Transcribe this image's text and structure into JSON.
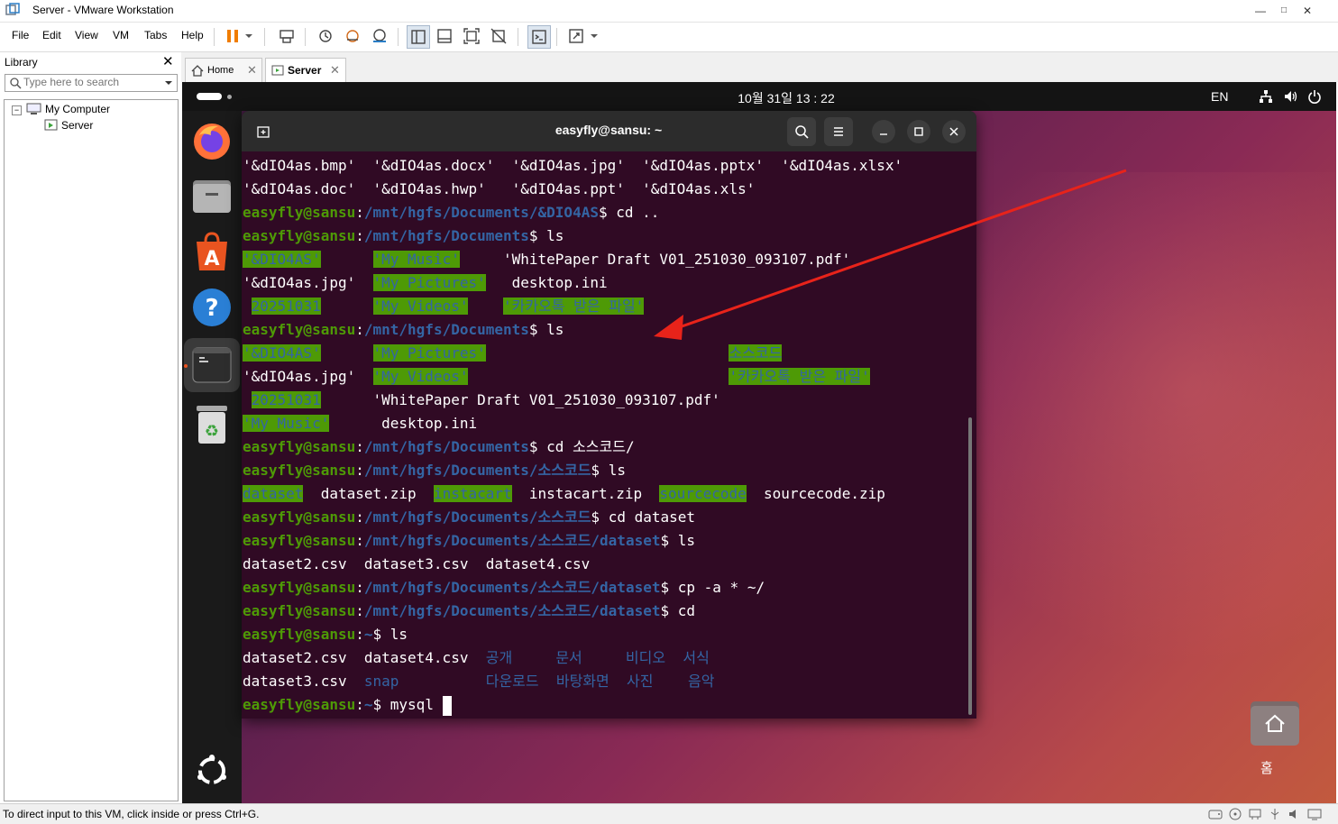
{
  "window": {
    "title": "Server - VMware Workstation",
    "minimize": "—",
    "maximize": "□",
    "close": "✕"
  },
  "menu": {
    "items": [
      "File",
      "Edit",
      "View",
      "VM",
      "Tabs",
      "Help"
    ]
  },
  "library": {
    "title": "Library",
    "close": "✕",
    "search_placeholder": "Type here to search",
    "tree": {
      "root": "My Computer",
      "child": "Server",
      "expander": "−"
    }
  },
  "tabs": [
    {
      "label": "Home",
      "active": false
    },
    {
      "label": "Server",
      "active": true
    }
  ],
  "vm": {
    "clock": "10월 31일  13 : 22",
    "lang": "EN",
    "terminal_title": "easyfly@sansu: ~",
    "home_folder_label": "홈"
  },
  "terminal": {
    "lines": [
      [
        {
          "t": "'&dIO4as.bmp'  '&dIO4as.docx'  '&dIO4as.jpg'  '&dIO4as.pptx'  '&dIO4as.xlsx'",
          "c": "w"
        }
      ],
      [
        {
          "t": "'&dIO4as.doc'  '&dIO4as.hwp'   '&dIO4as.ppt'  '&dIO4as.xls'",
          "c": "w"
        }
      ],
      [
        {
          "t": "easyfly@sansu",
          "c": "u"
        },
        {
          "t": ":",
          "c": "w"
        },
        {
          "t": "/mnt/hgfs/Documents/&DIO4AS",
          "c": "p"
        },
        {
          "t": "$ cd ..",
          "c": "w"
        }
      ],
      [
        {
          "t": "easyfly@sansu",
          "c": "u"
        },
        {
          "t": ":",
          "c": "w"
        },
        {
          "t": "/mnt/hgfs/Documents",
          "c": "p"
        },
        {
          "t": "$ ls",
          "c": "w"
        }
      ],
      [
        {
          "t": "'&DIO4AS'",
          "c": "h"
        },
        {
          "t": "      ",
          "c": "w"
        },
        {
          "t": "'My Music'",
          "c": "h"
        },
        {
          "t": "     'WhitePaper Draft V01_251030_093107.pdf'",
          "c": "w"
        }
      ],
      [
        {
          "t": "'&dIO4as.jpg'  ",
          "c": "w"
        },
        {
          "t": "'My Pictures'",
          "c": "h"
        },
        {
          "t": "   desktop.ini",
          "c": "w"
        }
      ],
      [
        {
          "t": " ",
          "c": "w"
        },
        {
          "t": "20251031",
          "c": "h"
        },
        {
          "t": "      ",
          "c": "w"
        },
        {
          "t": "'My Videos'",
          "c": "h"
        },
        {
          "t": "    ",
          "c": "w"
        },
        {
          "t": "'카카오톡 받은 파일'",
          "c": "h"
        }
      ],
      [
        {
          "t": "easyfly@sansu",
          "c": "u"
        },
        {
          "t": ":",
          "c": "w"
        },
        {
          "t": "/mnt/hgfs/Documents",
          "c": "p"
        },
        {
          "t": "$ ls",
          "c": "w"
        }
      ],
      [
        {
          "t": "'&DIO4AS'",
          "c": "h"
        },
        {
          "t": "      ",
          "c": "w"
        },
        {
          "t": "'My Pictures'",
          "c": "h"
        },
        {
          "t": "                            ",
          "c": "w"
        },
        {
          "t": "소스코드",
          "c": "h"
        }
      ],
      [
        {
          "t": "'&dIO4as.jpg'  ",
          "c": "w"
        },
        {
          "t": "'My Videos'",
          "c": "h"
        },
        {
          "t": "                              ",
          "c": "w"
        },
        {
          "t": "'카카오톡 받은 파일'",
          "c": "h"
        }
      ],
      [
        {
          "t": " ",
          "c": "w"
        },
        {
          "t": "20251031",
          "c": "h"
        },
        {
          "t": "      'WhitePaper Draft V01_251030_093107.pdf'",
          "c": "w"
        }
      ],
      [
        {
          "t": "'My Music'",
          "c": "h"
        },
        {
          "t": "      desktop.ini",
          "c": "w"
        }
      ],
      [
        {
          "t": "easyfly@sansu",
          "c": "u"
        },
        {
          "t": ":",
          "c": "w"
        },
        {
          "t": "/mnt/hgfs/Documents",
          "c": "p"
        },
        {
          "t": "$ cd 소스코드/",
          "c": "w"
        }
      ],
      [
        {
          "t": "easyfly@sansu",
          "c": "u"
        },
        {
          "t": ":",
          "c": "w"
        },
        {
          "t": "/mnt/hgfs/Documents/소스코드",
          "c": "p"
        },
        {
          "t": "$ ls",
          "c": "w"
        }
      ],
      [
        {
          "t": "dataset",
          "c": "h"
        },
        {
          "t": "  dataset.zip  ",
          "c": "w"
        },
        {
          "t": "instacart",
          "c": "h"
        },
        {
          "t": "  instacart.zip  ",
          "c": "w"
        },
        {
          "t": "sourcecode",
          "c": "h"
        },
        {
          "t": "  sourcecode.zip",
          "c": "w"
        }
      ],
      [
        {
          "t": "easyfly@sansu",
          "c": "u"
        },
        {
          "t": ":",
          "c": "w"
        },
        {
          "t": "/mnt/hgfs/Documents/소스코드",
          "c": "p"
        },
        {
          "t": "$ cd dataset",
          "c": "w"
        }
      ],
      [
        {
          "t": "easyfly@sansu",
          "c": "u"
        },
        {
          "t": ":",
          "c": "w"
        },
        {
          "t": "/mnt/hgfs/Documents/소스코드/dataset",
          "c": "p"
        },
        {
          "t": "$ ls",
          "c": "w"
        }
      ],
      [
        {
          "t": "dataset2.csv  dataset3.csv  dataset4.csv",
          "c": "w"
        }
      ],
      [
        {
          "t": "easyfly@sansu",
          "c": "u"
        },
        {
          "t": ":",
          "c": "w"
        },
        {
          "t": "/mnt/hgfs/Documents/소스코드/dataset",
          "c": "p"
        },
        {
          "t": "$ cp -a * ~/",
          "c": "w"
        }
      ],
      [
        {
          "t": "easyfly@sansu",
          "c": "u"
        },
        {
          "t": ":",
          "c": "w"
        },
        {
          "t": "/mnt/hgfs/Documents/소스코드/dataset",
          "c": "p"
        },
        {
          "t": "$ cd",
          "c": "w"
        }
      ],
      [
        {
          "t": "easyfly@sansu",
          "c": "u"
        },
        {
          "t": ":",
          "c": "w"
        },
        {
          "t": "~",
          "c": "p"
        },
        {
          "t": "$ ls",
          "c": "w"
        }
      ],
      [
        {
          "t": "dataset2.csv  dataset4.csv  ",
          "c": "w"
        },
        {
          "t": "공개     문서     비디오  서식",
          "c": "d"
        }
      ],
      [
        {
          "t": "dataset3.csv  ",
          "c": "w"
        },
        {
          "t": "snap          다운로드  바탕화면  사진    음악",
          "c": "d"
        }
      ],
      [
        {
          "t": "easyfly@sansu",
          "c": "u"
        },
        {
          "t": ":",
          "c": "w"
        },
        {
          "t": "~",
          "c": "p"
        },
        {
          "t": "$ mysql ",
          "c": "w"
        },
        {
          "t": "",
          "c": "cursor"
        }
      ]
    ]
  },
  "statusbar": {
    "text": "To direct input to this VM, click inside or press Ctrl+G."
  },
  "colors": {
    "terminal_bg": "#300a24",
    "user_green": "#4e9a06",
    "path_blue": "#3465a4",
    "annotation_arrow": "#e8231a"
  }
}
